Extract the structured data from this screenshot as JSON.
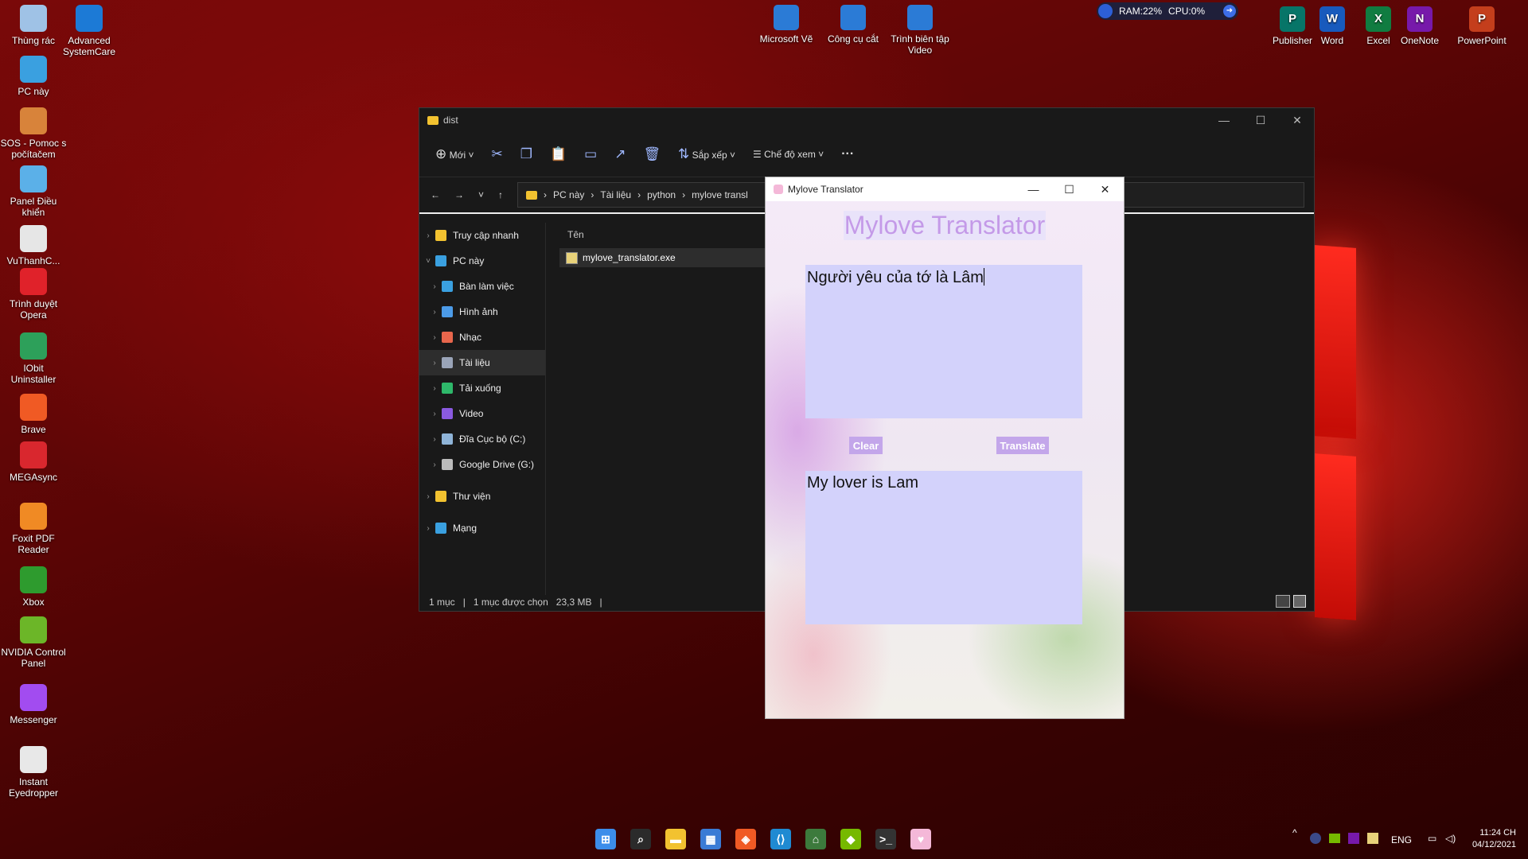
{
  "desktop_left": [
    {
      "label": "Thùng rác",
      "icon": "recycle-bin-icon",
      "color": "#9fc2e6"
    },
    {
      "label": "Advanced SystemCare",
      "icon": "systemcare-icon",
      "color": "#1c7ad6"
    },
    {
      "label": "PC này",
      "icon": "pc-icon",
      "color": "#3aa0e0"
    },
    {
      "label": "SOS - Pomoc s počítačem",
      "icon": "sos-icon",
      "color": "#d8833a"
    },
    {
      "label": "Panel Điều khiển",
      "icon": "control-panel-icon",
      "color": "#5bb0e8"
    },
    {
      "label": "VuThanhC...",
      "icon": "file-icon",
      "color": "#e6e6e6"
    },
    {
      "label": "Trình duyệt Opera",
      "icon": "opera-icon",
      "color": "#e0222a"
    },
    {
      "label": "IObit Uninstaller",
      "icon": "iobit-icon",
      "color": "#2da05a"
    },
    {
      "label": "Brave",
      "icon": "brave-icon",
      "color": "#f05a24"
    },
    {
      "label": "MEGAsync",
      "icon": "mega-icon",
      "color": "#d9272e"
    },
    {
      "label": "Foxit PDF Reader",
      "icon": "foxit-icon",
      "color": "#f08a24"
    },
    {
      "label": "Xbox",
      "icon": "xbox-icon",
      "color": "#2e9b2e"
    },
    {
      "label": "NVIDIA Control Panel",
      "icon": "nvidia-icon",
      "color": "#6cb628"
    },
    {
      "label": "Messenger",
      "icon": "messenger-icon",
      "color": "#a24cf0"
    },
    {
      "label": "Instant Eyedropper",
      "icon": "eyedropper-icon",
      "color": "#e8e8e8"
    }
  ],
  "desktop_top": [
    {
      "label": "Microsoft Vẽ",
      "icon": "paint-icon",
      "color": "#2b7bd6"
    },
    {
      "label": "Công cụ cắt",
      "icon": "snipping-icon",
      "color": "#2b7bd6"
    },
    {
      "label": "Trình biên tập Video",
      "icon": "video-editor-icon",
      "color": "#2b7bd6"
    }
  ],
  "desktop_right": [
    {
      "label": "Publisher",
      "icon": "publisher-icon",
      "color": "#077568",
      "letter": "P"
    },
    {
      "label": "Word",
      "icon": "word-icon",
      "color": "#185abd",
      "letter": "W"
    },
    {
      "label": "Excel",
      "icon": "excel-icon",
      "color": "#107c41",
      "letter": "X"
    },
    {
      "label": "OneNote",
      "icon": "onenote-icon",
      "color": "#7719aa",
      "letter": "N"
    },
    {
      "label": "PowerPoint",
      "icon": "powerpoint-icon",
      "color": "#c43e1c",
      "letter": "P"
    }
  ],
  "meter": {
    "ram": "RAM:22%",
    "cpu": "CPU:0%"
  },
  "explorer": {
    "title": "dist",
    "toolbar": {
      "new": "Mới",
      "sort": "Sắp xếp",
      "view": "Chế độ xem",
      "more": "···"
    },
    "path": [
      "PC này",
      "Tài liệu",
      "python",
      "mylove transl"
    ],
    "nav": [
      {
        "label": "Truy cập nhanh",
        "level": 0,
        "color": "#f2c230"
      },
      {
        "label": "PC này",
        "level": 0,
        "color": "#3aa0e0",
        "expanded": true
      },
      {
        "label": "Bàn làm việc",
        "level": 1,
        "color": "#3aa0e0"
      },
      {
        "label": "Hình ảnh",
        "level": 1,
        "color": "#4c9be8"
      },
      {
        "label": "Nhạc",
        "level": 1,
        "color": "#e8664c"
      },
      {
        "label": "Tài liệu",
        "level": 1,
        "color": "#9aa4b8",
        "selected": true
      },
      {
        "label": "Tải xuống",
        "level": 1,
        "color": "#2eb86a"
      },
      {
        "label": "Video",
        "level": 1,
        "color": "#8a5ae0"
      },
      {
        "label": "Đĩa Cục bộ (C:)",
        "level": 1,
        "color": "#8fb4d8"
      },
      {
        "label": "Google Drive (G:)",
        "level": 1,
        "color": "#bbbbbb"
      },
      {
        "label": "Thư viện",
        "level": 0,
        "color": "#f2c230"
      },
      {
        "label": "Mạng",
        "level": 0,
        "color": "#3aa0e0"
      }
    ],
    "column_name": "Tên",
    "file": "mylove_translator.exe",
    "status": {
      "count": "1 mục",
      "selected": "1 mục được chọn",
      "size": "23,3 MB"
    }
  },
  "translator": {
    "window_title": "Mylove Translator",
    "heading": "Mylove Translator",
    "input_text": "Người yêu của tớ là Lâm",
    "clear_label": "Clear",
    "translate_label": "Translate",
    "output_text": "My lover is Lam"
  },
  "taskbar": {
    "apps": [
      "start-icon",
      "search-icon",
      "file-explorer-icon",
      "store-icon",
      "brave-icon",
      "vscode-icon",
      "python-icon",
      "nvidia-icon",
      "terminal-icon",
      "mylove-translator-icon"
    ],
    "lang": "ENG",
    "time": "11:24 CH",
    "date": "04/12/2021"
  }
}
